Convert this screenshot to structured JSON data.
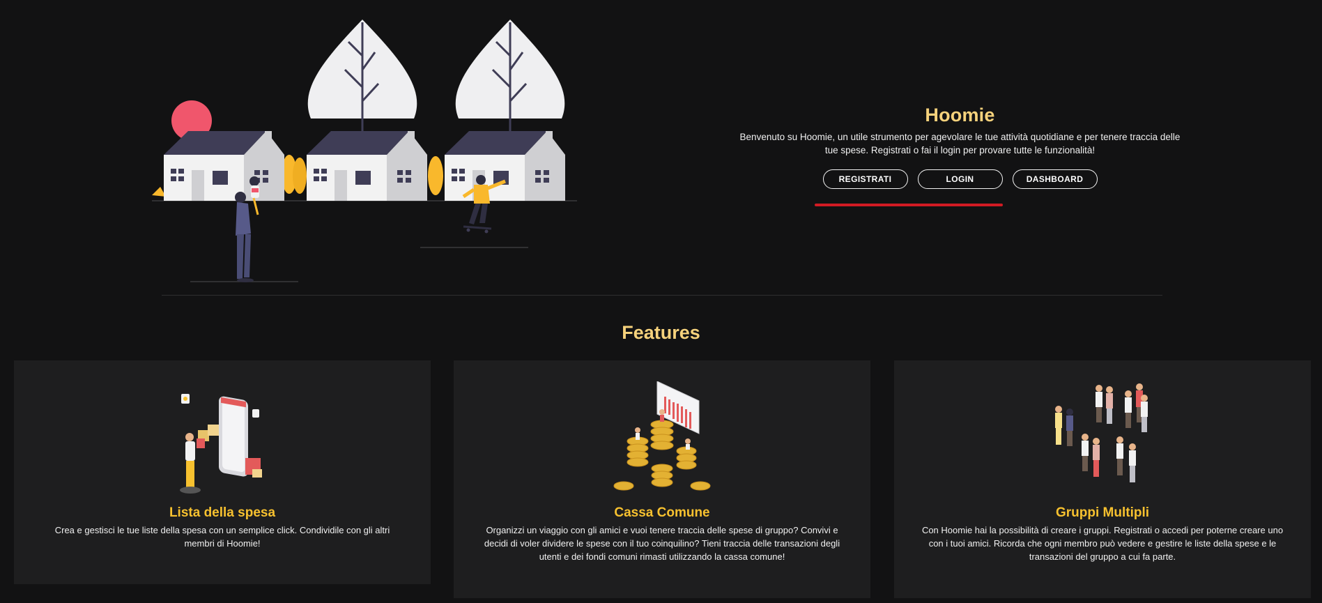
{
  "hero": {
    "title": "Hoomie",
    "welcome_text": "Benvenuto su Hoomie, un utile strumento per agevolare le tue attività quotidiane e per tenere traccia delle tue spese. Registrati o fai il login per provare tutte le funzionalità!",
    "buttons": {
      "register": "REGISTRATI",
      "login": "LOGIN",
      "dashboard": "DASHBOARD"
    }
  },
  "features": {
    "title": "Features",
    "cards": [
      {
        "title": "Lista della spesa",
        "text": "Crea e gestisci le tue liste della spesa con un semplice click. Condividile con gli altri membri di Hoomie!",
        "icon": "shopping-list-illustration"
      },
      {
        "title": "Cassa Comune",
        "text": "Organizzi un viaggio con gli amici e vuoi tenere traccia delle spese di gruppo? Convivi e decidi di voler dividere le spese con il tuo coinquilino? Tieni traccia delle transazioni degli utenti e dei fondi comuni rimasti utilizzando la cassa comune!",
        "icon": "coins-illustration"
      },
      {
        "title": "Gruppi Multipli",
        "text": "Con Hoomie hai la possibilità di creare i gruppi. Registrati o accedi per poterne creare uno con i tuoi amici. Ricorda che ogni membro può vedere e gestire le liste della spese e le transazioni del gruppo a cui fa parte.",
        "icon": "groups-illustration"
      }
    ]
  },
  "colors": {
    "background": "#121213",
    "card_background": "#1e1e1f",
    "accent_title": "#f6d27c",
    "card_title": "#f7c12f",
    "underline": "#d11b23"
  }
}
